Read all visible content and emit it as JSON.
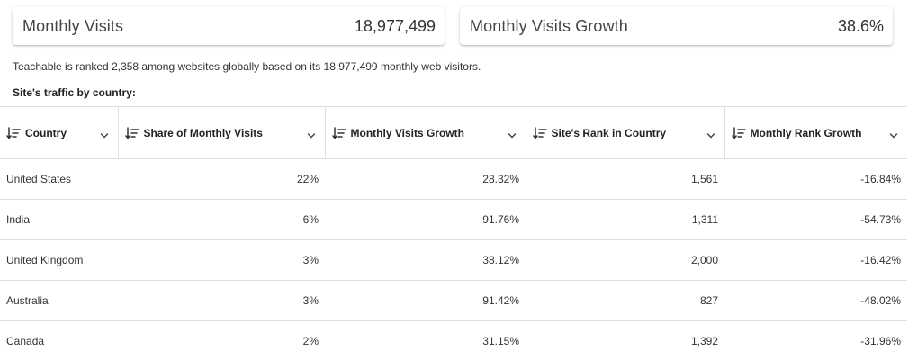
{
  "stats": {
    "visits_label": "Monthly Visits",
    "visits_value": "18,977,499",
    "growth_label": "Monthly Visits Growth",
    "growth_value": "38.6%"
  },
  "summary": "Teachable is ranked 2,358 among websites globally based on its 18,977,499 monthly web visitors.",
  "section_title": "Site's traffic by country:",
  "table": {
    "headers": [
      {
        "label": "Country",
        "icon": "sort-icon",
        "menu_icon": "chevron-down-icon"
      },
      {
        "label": "Share of Monthly Visits",
        "icon": "sort-icon",
        "menu_icon": "chevron-down-icon"
      },
      {
        "label": "Monthly Visits Growth",
        "icon": "sort-icon",
        "menu_icon": "chevron-down-icon"
      },
      {
        "label": "Site's Rank in Country",
        "icon": "sort-icon",
        "menu_icon": "chevron-down-icon"
      },
      {
        "label": "Monthly Rank Growth",
        "icon": "sort-icon",
        "menu_icon": "chevron-down-icon"
      }
    ],
    "rows": [
      {
        "country": "United States",
        "share": "22%",
        "growth": "28.32%",
        "rank": "1,561",
        "rank_growth": "-16.84%"
      },
      {
        "country": "India",
        "share": "6%",
        "growth": "91.76%",
        "rank": "1,311",
        "rank_growth": "-54.73%"
      },
      {
        "country": "United Kingdom",
        "share": "3%",
        "growth": "38.12%",
        "rank": "2,000",
        "rank_growth": "-16.42%"
      },
      {
        "country": "Australia",
        "share": "3%",
        "growth": "91.42%",
        "rank": "827",
        "rank_growth": "-48.02%"
      },
      {
        "country": "Canada",
        "share": "2%",
        "growth": "31.15%",
        "rank": "1,392",
        "rank_growth": "-31.96%"
      }
    ]
  }
}
